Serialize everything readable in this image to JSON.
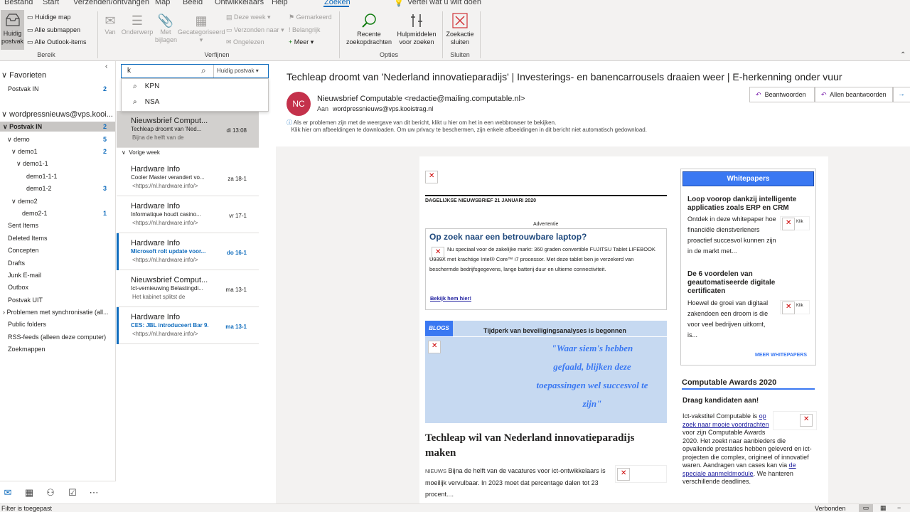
{
  "tabs": [
    "Bestand",
    "Start",
    "Verzenden/ontvangen",
    "Map",
    "Beeld",
    "Ontwikkelaars",
    "Help",
    "Zoeken"
  ],
  "tellme": "Vertel wat u wilt doen",
  "ribbon": {
    "scope": {
      "current_mailbox": "Huidig postvak",
      "current_folder": "Huidige map",
      "all_subfolders": "Alle submappen",
      "all_outlook": "Alle Outlook-items",
      "group": "Bereik"
    },
    "refine": {
      "from": "Van",
      "subject": "Onderwerp",
      "attach": "Met bijlagen",
      "categorized": "Gecategoriseerd",
      "this_week": "Deze week",
      "sent_to": "Verzonden naar",
      "unread": "Ongelezen",
      "flagged": "Gemarkeerd",
      "important": "Belangrijk",
      "more": "Meer",
      "group": "Verfijnen"
    },
    "options": {
      "recent": "Recente zoekopdrachten",
      "tools": "Hulpmiddelen voor zoeken",
      "group": "Opties"
    },
    "close": {
      "label": "Zoekactie sluiten",
      "group": "Sluiten"
    }
  },
  "folders": {
    "favorites": "Favorieten",
    "fav_inbox": "Postvak IN",
    "fav_inbox_count": "2",
    "account": "wordpressnieuws@vps.kooi...",
    "inbox": "Postvak IN",
    "inbox_count": "2",
    "demo": "demo",
    "demo_count": "5",
    "demo1": "demo1",
    "demo1_count": "2",
    "demo1_1": "demo1-1",
    "demo1_1_1": "demo1-1-1",
    "demo1_2": "demo1-2",
    "demo1_2_count": "3",
    "demo2": "demo2",
    "demo2_1": "demo2-1",
    "demo2_1_count": "1",
    "sent": "Sent Items",
    "deleted": "Deleted Items",
    "drafts_nl": "Concepten",
    "drafts": "Drafts",
    "junk": "Junk E-mail",
    "outbox": "Outbox",
    "postvak_uit": "Postvak UIT",
    "sync": "Problemen met synchronisatie (all...",
    "public": "Public folders",
    "rss": "RSS-feeds (alleen deze computer)",
    "search": "Zoekmappen"
  },
  "search": {
    "value": "k",
    "scope": "Huidig postvak",
    "suggestions": [
      "KPN",
      "NSA"
    ]
  },
  "list": {
    "group_header": "Vorige week",
    "first": {
      "sender": "Nieuwsbrief Comput...",
      "subject": "Techleap droomt van 'Ned...",
      "date": "di 13:08",
      "preview": "Bijna de helft van de"
    },
    "items": [
      {
        "sender": "Hardware Info",
        "subject": "Cooler Master verandert vo...",
        "date": "za 18-1",
        "preview": "<https://nl.hardware.info/>"
      },
      {
        "sender": "Hardware Info",
        "subject": "Informatique houdt casino...",
        "date": "vr 17-1",
        "preview": "<https://nl.hardware.info/>"
      },
      {
        "sender": "Hardware Info",
        "subject": "Microsoft rolt update voor...",
        "date": "do 16-1",
        "preview": "<https://nl.hardware.info/>"
      },
      {
        "sender": "Nieuwsbrief Comput...",
        "subject": "Ict-vernieuwing Belastingdi...",
        "date": "ma 13-1",
        "preview": "Het kabinet splitst de"
      },
      {
        "sender": "Hardware Info",
        "subject": "CES: JBL introduceert Bar 9...",
        "date": "ma 13-1",
        "preview": "<https://nl.hardware.info/>"
      }
    ]
  },
  "message": {
    "subject": "Techleap droomt van 'Nederland innovatieparadijs' | Investerings- en banencarrousels draaien weer | E-herkenning onder vuur",
    "avatar": "NC",
    "from": "Nieuwsbrief Computable <redactie@mailing.computable.nl>",
    "to_label": "Aan",
    "to": "wordpressnieuws@vps.kooistrag.nl",
    "reply": "Beantwoorden",
    "reply_all": "Allen beantwoorden",
    "info1": "Als er problemen zijn met de weergave van dit bericht, klikt u hier om het in een webbrowser te bekijken.",
    "info2": "Klik hier om afbeeldingen te downloaden. Om uw privacy te beschermen, zijn enkele afbeeldingen in dit bericht niet automatisch gedownload."
  },
  "newsletter": {
    "dateline": "DAGELIJKSE NIEUWSBRIEF 21 JANUARI 2020",
    "ad_label": "Advertentie",
    "ad_title": "Op zoek naar een betrouwbare laptop?",
    "ad_body": "Nu speciaal voor de zakelijke markt: 360 graden convertible FUJITSU Tablet LIFEBOOK U939X met krachtige Intel® Core™ i7 processor. Met deze tablet ben je verzekerd van beschermde bedrijfsgegevens, lange batterij duur en ultieme connectiviteit.",
    "ad_link": "Bekijk hem hier!",
    "blog_tag": "BLOGS",
    "blog_title": "Tijdperk van beveiligingsanalyses is begonnen",
    "blog_quote": "\"Waar siem's hebben gefaald, blijken deze toepassingen wel succesvol te zijn\"",
    "article_title": "Techleap wil van Nederland innovatieparadijs maken",
    "article_tag": "NIEUWS",
    "article_body": "Bijna de helft van de vacatures voor ict-ontwikkelaars is moeilijk vervulbaar. In 2023 moet dat percentage dalen tot 23 procent....",
    "wp_header": "Whitepapers",
    "wp1_title": "Loop voorop dankzij intelligente applicaties zoals ERP en CRM",
    "wp1_body": "Ontdek in deze whitepaper hoe financiële dienstverleners proactief succesvol kunnen zijn in de markt met...",
    "wp2_title": "De 6 voordelen van geautomatiseerde digitale certificaten",
    "wp2_body": "Hoewel de groei van digitaal zakendoen een droom is die voor veel bedrijven uitkomt, is...",
    "wp_click": "Klik",
    "wp_more": "MEER WHITEPAPERS",
    "awards_title": "Computable Awards 2020",
    "awards_sub": "Draag kandidaten aan!",
    "awards_body_1": "Ict-vakstitel Computable is",
    "awards_link1": "op zoek naar mooie voordrachten",
    "awards_body_2": "voor zijn Computable Awards 2020. Het zoekt naar aanbieders die opvallende prestaties hebben geleverd en ict-projecten die complex, origineel of innovatief waren. Aandragen van cases kan via",
    "awards_link2": "de speciale aanmeldmodule",
    "awards_body_3": ". We hanteren verschillende deadlines."
  },
  "status": {
    "left": "Filter is toegepast",
    "right": "Verbonden"
  },
  "colors": {
    "accent": "#0f6cbd",
    "avatar": "#c4314b",
    "blog_bg": "#c6d9f1",
    "wp_header": "#3a78f2"
  }
}
